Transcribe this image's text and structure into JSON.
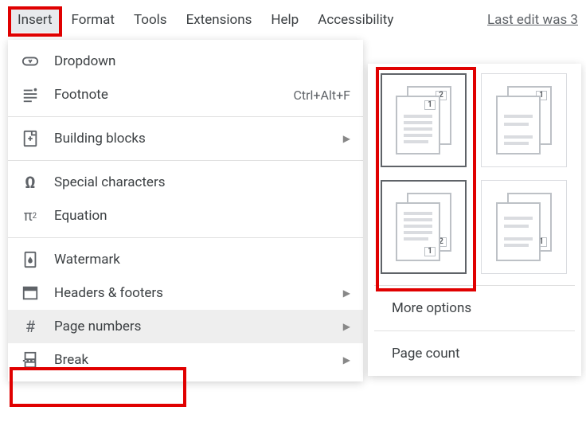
{
  "menubar": {
    "items": [
      {
        "label": "Insert",
        "active": true
      },
      {
        "label": "Format"
      },
      {
        "label": "Tools"
      },
      {
        "label": "Extensions"
      },
      {
        "label": "Help"
      },
      {
        "label": "Accessibility"
      }
    ],
    "last_edit": "Last edit was 3"
  },
  "menu": {
    "dropdown_label": "Dropdown",
    "footnote_label": "Footnote",
    "footnote_shortcut": "Ctrl+Alt+F",
    "building_blocks_label": "Building blocks",
    "special_chars_label": "Special characters",
    "equation_label": "Equation",
    "watermark_label": "Watermark",
    "headers_footers_label": "Headers & footers",
    "page_numbers_label": "Page numbers",
    "break_label": "Break"
  },
  "submenu": {
    "thumbnails": [
      {
        "name": "header-number-first-page-one",
        "selected": true
      },
      {
        "name": "header-number-skip-first",
        "selected": false
      },
      {
        "name": "footer-number-first-page-one",
        "selected": true
      },
      {
        "name": "footer-number-skip-first",
        "selected": false
      }
    ],
    "more_options_label": "More options",
    "page_count_label": "Page count"
  }
}
